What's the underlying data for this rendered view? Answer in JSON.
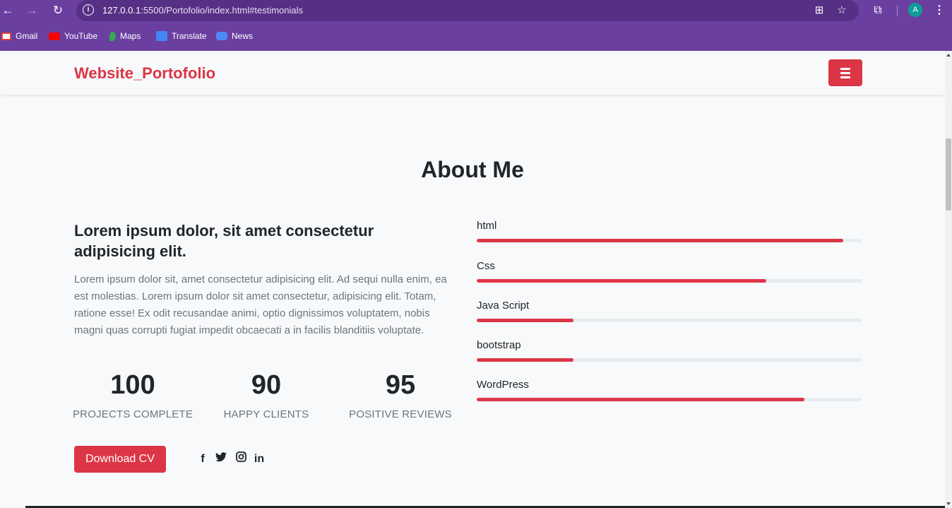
{
  "browser": {
    "url_host": "127.0.0.1",
    "url_rest": ":5500/Portofolio/index.html#testimonials",
    "avatar_letter": "A",
    "bookmarks": [
      {
        "label": "Gmail"
      },
      {
        "label": "YouTube"
      },
      {
        "label": "Maps"
      },
      {
        "label": "Translate"
      },
      {
        "label": "News"
      }
    ]
  },
  "navbar": {
    "brand": "Website_Portofolio"
  },
  "about": {
    "title": "About Me",
    "lead_title": "Lorem ipsum dolor, sit amet consectetur adipisicing elit.",
    "lead_text": "Lorem ipsum dolor sit, amet consectetur adipisicing elit. Ad sequi nulla enim, ea est molestias. Lorem ipsum dolor sit amet consectetur, adipisicing elit. Totam, ratione esse! Ex odit recusandae animi, optio dignissimos voluptatem, nobis magni quas corrupti fugiat impedit obcaecati a in facilis blanditiis voluptate.",
    "stats": [
      {
        "value": "100",
        "label": "PROJECTS COMPLETE"
      },
      {
        "value": "90",
        "label": "HAPPY CLIENTS"
      },
      {
        "value": "95",
        "label": "POSITIVE REVIEWS"
      }
    ],
    "download_cv": "Download CV",
    "skills": [
      {
        "name": "html",
        "percent": 95
      },
      {
        "name": "Css",
        "percent": 75
      },
      {
        "name": "Java Script",
        "percent": 25
      },
      {
        "name": "bootstrap",
        "percent": 25
      },
      {
        "name": "WordPress",
        "percent": 85
      }
    ]
  },
  "colors": {
    "accent": "#dc3545",
    "browser_frame": "#6b3fa0"
  }
}
